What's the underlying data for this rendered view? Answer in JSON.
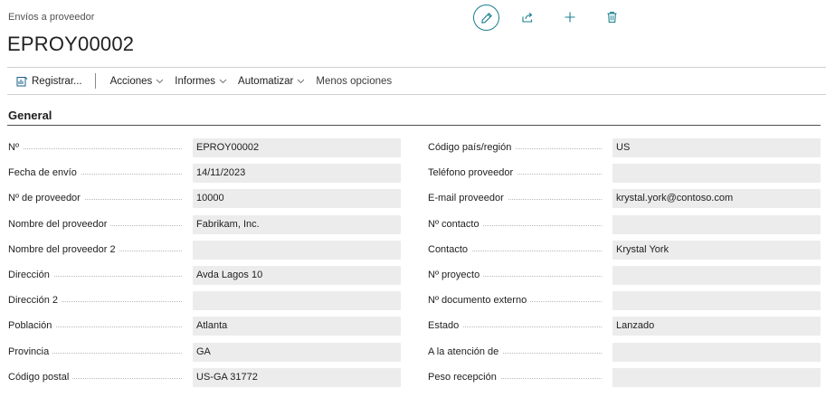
{
  "breadcrumb": "Envíos a proveedor",
  "title": "EPROY00002",
  "top_actions": [
    {
      "name": "edit",
      "icon": "pencil-icon"
    },
    {
      "name": "share",
      "icon": "share-icon"
    },
    {
      "name": "add",
      "icon": "plus-icon"
    },
    {
      "name": "delete",
      "icon": "trash-icon"
    }
  ],
  "actionbar": {
    "registrar": "Registrar...",
    "acciones": "Acciones",
    "informes": "Informes",
    "automatizar": "Automatizar",
    "menos_opciones": "Menos opciones"
  },
  "section": {
    "title": "General"
  },
  "left_fields": [
    {
      "label": "Nº",
      "value": "EPROY00002"
    },
    {
      "label": "Fecha de envío",
      "value": "14/11/2023"
    },
    {
      "label": "Nº de proveedor",
      "value": "10000"
    },
    {
      "label": "Nombre del proveedor",
      "value": "Fabrikam, Inc."
    },
    {
      "label": "Nombre del proveedor 2",
      "value": ""
    },
    {
      "label": "Dirección",
      "value": "Avda Lagos 10"
    },
    {
      "label": "Dirección 2",
      "value": ""
    },
    {
      "label": "Población",
      "value": "Atlanta"
    },
    {
      "label": "Provincia",
      "value": "GA"
    },
    {
      "label": "Código postal",
      "value": "US-GA 31772"
    }
  ],
  "right_fields": [
    {
      "label": "Código país/región",
      "value": "US"
    },
    {
      "label": "Teléfono proveedor",
      "value": ""
    },
    {
      "label": "E-mail proveedor",
      "value": "krystal.york@contoso.com"
    },
    {
      "label": "Nº contacto",
      "value": ""
    },
    {
      "label": "Contacto",
      "value": "Krystal York"
    },
    {
      "label": "Nº proyecto",
      "value": ""
    },
    {
      "label": "Nº documento externo",
      "value": ""
    },
    {
      "label": "Estado",
      "value": "Lanzado"
    },
    {
      "label": "A la atención de",
      "value": ""
    },
    {
      "label": "Peso recepción",
      "value": ""
    }
  ],
  "colors": {
    "accent": "#1a7f8e",
    "field_bg": "#ececec"
  }
}
